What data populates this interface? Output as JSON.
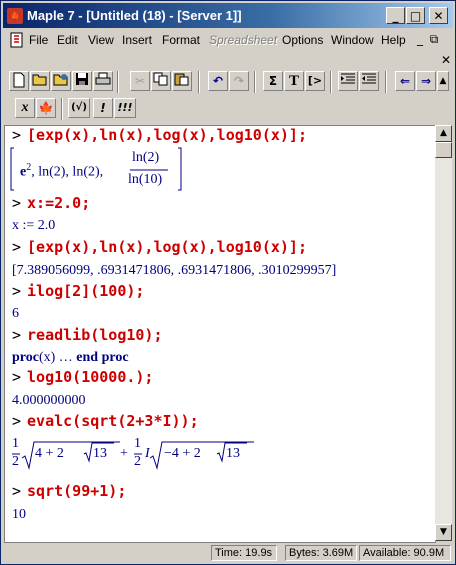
{
  "window": {
    "title": "Maple 7  - [Untitled (18) - [Server 1]]",
    "controls": [
      "_",
      "□",
      "✕"
    ]
  },
  "menu": {
    "items": [
      "File",
      "Edit",
      "View",
      "Insert",
      "Format",
      "Spreadsheet",
      "Options",
      "Window",
      "Help"
    ],
    "disabled": [
      "Spreadsheet"
    ],
    "mdi_controls": [
      "_",
      "⧉",
      "✕"
    ]
  },
  "toolbar1": {
    "icons": [
      "new-icon",
      "open-icon",
      "open-url-icon",
      "save-icon",
      "print-icon",
      "cut-icon",
      "copy-icon",
      "paste-icon",
      "undo-icon",
      "redo-icon",
      "sum-icon",
      "text-icon",
      "prompt-icon",
      "indent-icon",
      "outdent-icon",
      "back-icon",
      "forward-icon",
      "stop-icon"
    ],
    "labels": {
      "sum": "Σ",
      "text": "T",
      "prompt": "[>"
    }
  },
  "toolbar2": {
    "labels": {
      "x": "x",
      "sqrt": "(√)",
      "exec": "!",
      "execall": "!!!"
    }
  },
  "worksheet": {
    "prompt": ">",
    "cmd1": "[exp(x),ln(x),log(x),log10(x)];",
    "out1_e": "e",
    "out1_exp": "2",
    "out1_mid": ", ln(2), ln(2), ",
    "out1_num": "ln(2)",
    "out1_den": "ln(10)",
    "cmd2": "x:=2.0;",
    "out2": "x := 2.0",
    "cmd3": "[exp(x),ln(x),log(x),log10(x)];",
    "out3": "[7.389056099, .6931471806, .6931471806, .3010299957]",
    "cmd4": "ilog[2](100);",
    "out4": "6",
    "cmd5": "readlib(log10);",
    "out5_proc": "proc",
    "out5_arg": "(x)",
    "out5_dots": " … ",
    "out5_end": "end proc",
    "cmd6": "log10(10000.);",
    "out6": "4.000000000",
    "cmd7": "evalc(sqrt(2+3*I));",
    "out7_a": "4 + 2",
    "out7_b": "13",
    "out7_plus": "+",
    "out7_I": "I",
    "out7_c": "−4 + 2",
    "out7_d": "13",
    "out7_one": "1",
    "out7_two": "2",
    "cmd8": "sqrt(99+1);",
    "out8": "10"
  },
  "status": {
    "time": "Time:  19.9s",
    "bytes": "Bytes: 3.69M",
    "available": "Available: 90.9M"
  }
}
